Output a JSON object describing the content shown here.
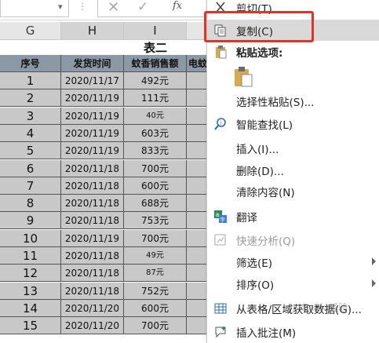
{
  "formula_bar": {
    "fx_label": "fx",
    "cancel_symbol": "✕",
    "enter_symbol": "✓",
    "more_symbol": "⋮"
  },
  "columns": [
    "G",
    "H",
    "I"
  ],
  "table": {
    "title": "表二",
    "headers": [
      "序号",
      "发货时间",
      "蚊香销售额",
      "电蚊"
    ],
    "rows": [
      {
        "seq": "1",
        "date": "2020/11/17",
        "amount": "492元"
      },
      {
        "seq": "2",
        "date": "2020/11/19",
        "amount": "111元"
      },
      {
        "seq": "3",
        "date": "2020/11/19",
        "amount": "40元"
      },
      {
        "seq": "4",
        "date": "2020/11/19",
        "amount": "603元"
      },
      {
        "seq": "5",
        "date": "2020/11/19",
        "amount": "833元"
      },
      {
        "seq": "6",
        "date": "2020/11/18",
        "amount": "700元"
      },
      {
        "seq": "7",
        "date": "2020/11/18",
        "amount": "600元"
      },
      {
        "seq": "8",
        "date": "2020/11/18",
        "amount": "688元"
      },
      {
        "seq": "9",
        "date": "2020/11/18",
        "amount": "753元"
      },
      {
        "seq": "10",
        "date": "2020/11/19",
        "amount": "700元"
      },
      {
        "seq": "11",
        "date": "2020/11/18",
        "amount": "49元"
      },
      {
        "seq": "12",
        "date": "2020/11/18",
        "amount": "87元"
      },
      {
        "seq": "13",
        "date": "2020/11/18",
        "amount": "752元"
      },
      {
        "seq": "14",
        "date": "2020/11/20",
        "amount": "600元"
      },
      {
        "seq": "15",
        "date": "2020/11/20",
        "amount": "700元"
      }
    ]
  },
  "context_menu": {
    "cut": "剪切(T)",
    "copy": "复制(C)",
    "paste_options": "粘贴选项:",
    "paste_special": "选择性粘贴(S)...",
    "smart_lookup": "智能查找(L)",
    "insert": "插入(I)...",
    "delete": "删除(D)...",
    "clear_contents": "清除内容(N)",
    "translate": "翻译",
    "quick_analysis": "快速分析(Q)",
    "filter": "筛选(E)",
    "sort": "排序(O)",
    "get_data": "从表格/区域获取数据(G)...",
    "insert_comment": "插入批注(M)"
  },
  "watermark": "Baidu经验",
  "colors": {
    "highlight_border": "#e8302a",
    "header_fill": "#8c98a6",
    "cell_fill": "#c8c8c8"
  }
}
